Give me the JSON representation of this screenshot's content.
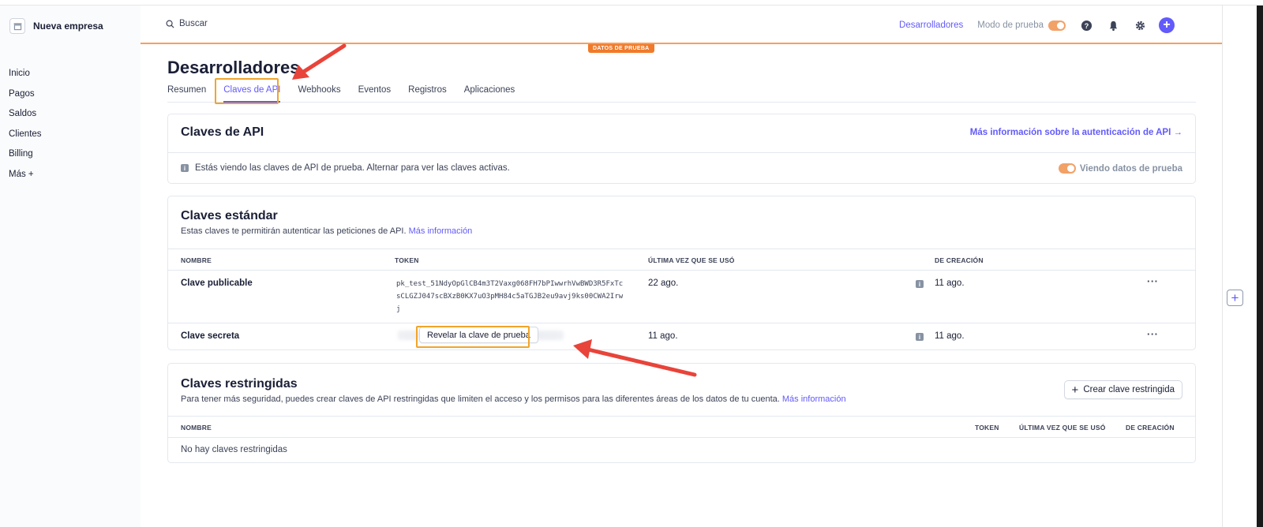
{
  "sidebar": {
    "company_name": "Nueva empresa",
    "nav": [
      "Inicio",
      "Pagos",
      "Saldos",
      "Clientes",
      "Billing",
      "Más +"
    ]
  },
  "header": {
    "search_placeholder": "Buscar",
    "developers_link": "Desarrolladores",
    "test_mode_label": "Modo de prueba",
    "test_badge": "DATOS DE PRUEBA",
    "icons": [
      "help-icon",
      "bell-icon",
      "gear-icon",
      "plus-icon"
    ]
  },
  "page": {
    "title": "Desarrolladores",
    "tabs": [
      "Resumen",
      "Claves de API",
      "Webhooks",
      "Eventos",
      "Registros",
      "Aplicaciones"
    ],
    "active_tab": "Claves de API"
  },
  "api_keys_card": {
    "title": "Claves de API",
    "more_link": "Más información sobre la autenticación de API →",
    "info_text": "Estás viendo las claves de API de prueba. Alternar para ver las claves activas.",
    "view_test_label": "Viendo datos de prueba"
  },
  "standard_keys": {
    "title": "Claves estándar",
    "subtitle": "Estas claves te permitirán autenticar las peticiones de API.",
    "subtitle_link": "Más información",
    "columns": [
      "NOMBRE",
      "TOKEN",
      "ÚLTIMA VEZ QUE SE USÓ",
      "DE CREACIÓN"
    ],
    "rows": [
      {
        "name": "Clave publicable",
        "token": "pk_test_51NdyOpGlCB4m3T2Vaxg068FH7bPIwwrhVwBWD3R5FxTcsCLGZJ047scBXzB0KX7uO3pMH84c5aTGJB2eu9avj9ks00CWA2Irwj",
        "last_used": "22 ago.",
        "created": "11 ago."
      },
      {
        "name": "Clave secreta",
        "reveal_label": "Revelar la clave de prueba",
        "last_used": "11 ago.",
        "created": "11 ago."
      }
    ]
  },
  "restricted_keys": {
    "title": "Claves restringidas",
    "subtitle": "Para tener más seguridad, puedes crear claves de API restringidas que limiten el acceso y los permisos para las diferentes áreas de los datos de tu cuenta.",
    "subtitle_link": "Más información",
    "create_button": "Crear clave restringida",
    "columns": [
      "NOMBRE",
      "TOKEN",
      "ÚLTIMA VEZ QUE SE USÓ",
      "DE CREACIÓN"
    ],
    "empty_text": "No hay claves restringidas"
  },
  "colors": {
    "accent": "#625afa",
    "test_orange": "#f07a2a",
    "annotation_red": "#e8443a",
    "highlight": "#f0a52b"
  }
}
